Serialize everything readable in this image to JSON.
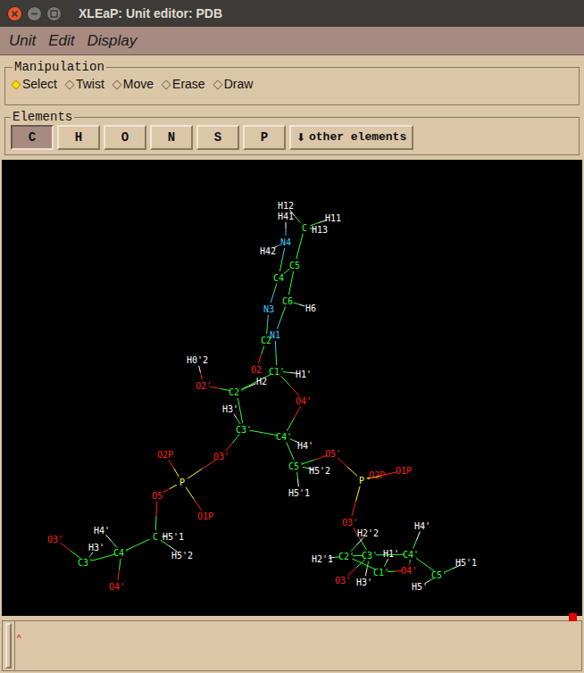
{
  "window": {
    "title": "XLEaP: Unit editor: PDB"
  },
  "menu": [
    "Unit",
    "Edit",
    "Display"
  ],
  "manipulation": {
    "title": "Manipulation",
    "options": [
      {
        "label": "Select",
        "selected": true
      },
      {
        "label": "Twist",
        "selected": false
      },
      {
        "label": "Move",
        "selected": false
      },
      {
        "label": "Erase",
        "selected": false
      },
      {
        "label": "Draw",
        "selected": false
      }
    ]
  },
  "elements": {
    "title": "Elements",
    "buttons": [
      {
        "label": "C",
        "selected": true
      },
      {
        "label": "H",
        "selected": false
      },
      {
        "label": "O",
        "selected": false
      },
      {
        "label": "N",
        "selected": false
      },
      {
        "label": "S",
        "selected": false
      },
      {
        "label": "P",
        "selected": false
      }
    ],
    "other": {
      "icon": "⬇",
      "label": "other elements"
    }
  },
  "molecule": {
    "atoms": [
      {
        "label": "H12",
        "color": "#ffffff"
      },
      {
        "label": "H41",
        "color": "#ffffff"
      },
      {
        "label": "C",
        "color": "#33ff33"
      },
      {
        "label": "H11",
        "color": "#ffffff"
      },
      {
        "label": "H13",
        "color": "#ffffff"
      },
      {
        "label": "N4",
        "color": "#33ccff"
      },
      {
        "label": "H42",
        "color": "#ffffff"
      },
      {
        "label": "C5",
        "color": "#33ff33"
      },
      {
        "label": "C4",
        "color": "#33ff33"
      },
      {
        "label": "C6",
        "color": "#33ff33"
      },
      {
        "label": "H6",
        "color": "#ffffff"
      },
      {
        "label": "N3",
        "color": "#33ccff"
      },
      {
        "label": "N1",
        "color": "#33ccff"
      },
      {
        "label": "C2",
        "color": "#33ff33"
      },
      {
        "label": "O2",
        "color": "#ff2020"
      },
      {
        "label": "C1'",
        "color": "#33ff33"
      },
      {
        "label": "H1'",
        "color": "#ffffff"
      },
      {
        "label": "H2",
        "color": "#ffffff"
      },
      {
        "label": "H0'2",
        "color": "#ffffff"
      },
      {
        "label": "O2'",
        "color": "#ff2020"
      },
      {
        "label": "C2'",
        "color": "#33ff33"
      },
      {
        "label": "H3'",
        "color": "#ffffff"
      },
      {
        "label": "C3'",
        "color": "#33ff33"
      },
      {
        "label": "O4'",
        "color": "#ff2020"
      },
      {
        "label": "C4'",
        "color": "#33ff33"
      },
      {
        "label": "H4'",
        "color": "#ffffff"
      },
      {
        "label": "C5'",
        "color": "#33ff33"
      },
      {
        "label": "H5'2",
        "color": "#ffffff"
      },
      {
        "label": "H5'1",
        "color": "#ffffff"
      },
      {
        "label": "O5'",
        "color": "#ff2020"
      },
      {
        "label": "O3'",
        "color": "#ff2020"
      },
      {
        "label": "O2P",
        "color": "#ff2020"
      },
      {
        "label": "P",
        "color": "#ffff33"
      },
      {
        "label": "O5",
        "color": "#ff2020"
      },
      {
        "label": "O1P",
        "color": "#ff2020"
      },
      {
        "label": "C",
        "color": "#33ff33"
      },
      {
        "label": "H5'1",
        "color": "#ffffff"
      },
      {
        "label": "H5'2",
        "color": "#ffffff"
      },
      {
        "label": "H4'",
        "color": "#ffffff"
      },
      {
        "label": "H3'",
        "color": "#ffffff"
      },
      {
        "label": "C4'",
        "color": "#33ff33"
      },
      {
        "label": "C3'",
        "color": "#33ff33"
      },
      {
        "label": "O3'",
        "color": "#ff2020"
      },
      {
        "label": "O4'",
        "color": "#ff2020"
      },
      {
        "label": "P",
        "color": "#ffff33"
      },
      {
        "label": "O2P",
        "color": "#ff2020"
      },
      {
        "label": "O1P",
        "color": "#ff2020"
      },
      {
        "label": "O3'",
        "color": "#ff2020"
      },
      {
        "label": "H2'2",
        "color": "#ffffff"
      },
      {
        "label": "H4'",
        "color": "#ffffff"
      },
      {
        "label": "H2'1",
        "color": "#ffffff"
      },
      {
        "label": "C2'",
        "color": "#33ff33"
      },
      {
        "label": "C3'",
        "color": "#33ff33"
      },
      {
        "label": "H1'",
        "color": "#ffffff"
      },
      {
        "label": "C4'",
        "color": "#33ff33"
      },
      {
        "label": "H5'1",
        "color": "#ffffff"
      },
      {
        "label": "C1'",
        "color": "#33ff33"
      },
      {
        "label": "O4'",
        "color": "#ff2020"
      },
      {
        "label": "C5'",
        "color": "#33ff33"
      },
      {
        "label": "H5'",
        "color": "#ffffff"
      },
      {
        "label": "H3'",
        "color": "#ffffff"
      },
      {
        "label": "O3'",
        "color": "#ff2020"
      }
    ],
    "bonds": [
      [
        1,
        5
      ],
      [
        0,
        2
      ],
      [
        3,
        2
      ],
      [
        4,
        2
      ],
      [
        2,
        7
      ],
      [
        5,
        8
      ],
      [
        6,
        5
      ],
      [
        7,
        8
      ],
      [
        7,
        9
      ],
      [
        9,
        10
      ],
      [
        9,
        12
      ],
      [
        8,
        11
      ],
      [
        11,
        13
      ],
      [
        12,
        13
      ],
      [
        13,
        14
      ],
      [
        12,
        15
      ],
      [
        15,
        16
      ],
      [
        15,
        20
      ],
      [
        15,
        23
      ],
      [
        17,
        20
      ],
      [
        18,
        19
      ],
      [
        19,
        20
      ],
      [
        20,
        22
      ],
      [
        21,
        22
      ],
      [
        22,
        24
      ],
      [
        23,
        24
      ],
      [
        24,
        25
      ],
      [
        24,
        26
      ],
      [
        26,
        27
      ],
      [
        26,
        28
      ],
      [
        26,
        29
      ],
      [
        29,
        44
      ],
      [
        22,
        30
      ],
      [
        30,
        32
      ],
      [
        31,
        32
      ],
      [
        32,
        33
      ],
      [
        32,
        34
      ],
      [
        33,
        35
      ],
      [
        35,
        36
      ],
      [
        35,
        37
      ],
      [
        35,
        40
      ],
      [
        40,
        38
      ],
      [
        41,
        39
      ],
      [
        40,
        41
      ],
      [
        41,
        42
      ],
      [
        40,
        43
      ],
      [
        44,
        45
      ],
      [
        44,
        46
      ],
      [
        44,
        47
      ],
      [
        47,
        52
      ],
      [
        52,
        51
      ],
      [
        51,
        48
      ],
      [
        51,
        50
      ],
      [
        51,
        56
      ],
      [
        56,
        53
      ],
      [
        52,
        54
      ],
      [
        54,
        49
      ],
      [
        54,
        57
      ],
      [
        57,
        56
      ],
      [
        54,
        58
      ],
      [
        58,
        55
      ],
      [
        58,
        59
      ],
      [
        52,
        60
      ],
      [
        52,
        61
      ]
    ]
  },
  "console": {
    "cursor": "^"
  }
}
